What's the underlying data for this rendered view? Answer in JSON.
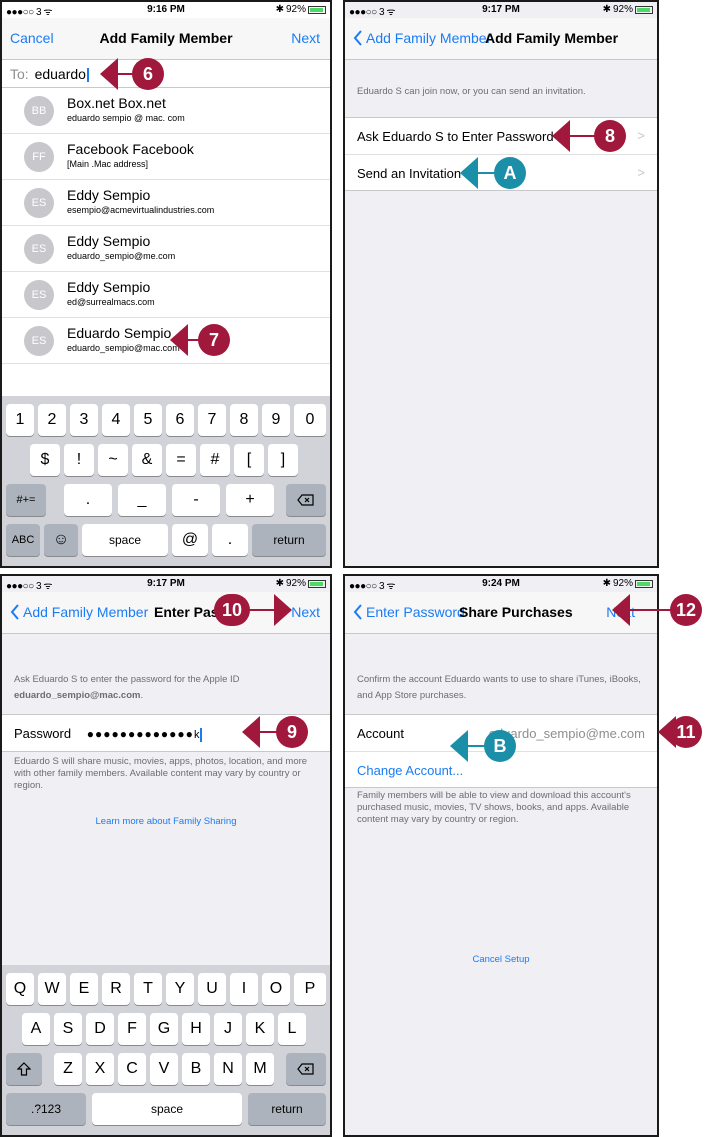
{
  "colors": {
    "ios_blue": "#1a7cf5",
    "callout_red": "#a0183c",
    "callout_teal": "#1c8fa8"
  },
  "panel1": {
    "status": {
      "carrier": "●●●○○ 3 ᯤ",
      "time": "9:16 PM",
      "battery": "92%",
      "battery_level": 0.92
    },
    "nav": {
      "left": "Cancel",
      "title": "Add Family Member",
      "right": "Next"
    },
    "to_label": "To:",
    "to_value": "eduardo",
    "contacts": [
      {
        "initials": "BB",
        "name": "Box.net Box.net",
        "email": "eduardo sempio @ mac. com"
      },
      {
        "initials": "FF",
        "name": "Facebook Facebook",
        "email": "[Main .Mac address]"
      },
      {
        "initials": "ES",
        "name": "Eddy Sempio",
        "email": "esempio@acmevirtualindustries.com"
      },
      {
        "initials": "ES",
        "name": "Eddy Sempio",
        "email": "eduardo_sempio@me.com"
      },
      {
        "initials": "ES",
        "name": "Eddy Sempio",
        "email": "ed@surrealmacs.com"
      },
      {
        "initials": "ES",
        "name": "Eduardo Sempio",
        "email": "eduardo_sempio@mac.com"
      }
    ],
    "keyboard": {
      "row1": [
        "1",
        "2",
        "3",
        "4",
        "5",
        "6",
        "7",
        "8",
        "9",
        "0"
      ],
      "row2": [
        "$",
        "!",
        "~",
        "&",
        "=",
        "#",
        "[",
        "]"
      ],
      "row3": [
        ".",
        "_",
        "-",
        "+"
      ],
      "row3_left": "#+=",
      "backspace_icon": "backspace-icon",
      "abc": "ABC",
      "emoji": "☺",
      "space": "space",
      "at": "@",
      "dot": ".",
      "return": "return"
    },
    "callouts": {
      "to": "6",
      "contact": "7"
    }
  },
  "panel2": {
    "status": {
      "carrier": "●●●○○ 3 ᯤ",
      "time": "9:17 PM",
      "battery": "92%",
      "battery_level": 0.92
    },
    "nav": {
      "back": "Add Family Member",
      "title": "Add Family Member"
    },
    "info": "Eduardo S can join now, or you can send an invitation.",
    "options": [
      "Ask Eduardo S to Enter Password",
      "Send an Invitation"
    ],
    "callouts": {
      "ask": "8",
      "send": "A"
    }
  },
  "panel3": {
    "status": {
      "carrier": "●●●○○ 3 ᯤ",
      "time": "9:17 PM",
      "battery": "92%",
      "battery_level": 0.92
    },
    "nav": {
      "back": "Add Family Member",
      "title": "Enter Pass",
      "right": "Next"
    },
    "info_line1": "Ask Eduardo S to enter the password for the Apple ID",
    "info_email": "eduardo_sempio@mac.com",
    "info_end": ".",
    "password_label": "Password",
    "password_dots": "●●●●●●●●●●●●●",
    "password_last": "k",
    "footnote": "Eduardo S will share music, movies, apps, photos, location, and more with other family members. Available content may vary by country or region.",
    "learn_more": "Learn more about Family Sharing",
    "keyboard": {
      "row1": [
        "Q",
        "W",
        "E",
        "R",
        "T",
        "Y",
        "U",
        "I",
        "O",
        "P"
      ],
      "row2": [
        "A",
        "S",
        "D",
        "F",
        "G",
        "H",
        "J",
        "K",
        "L"
      ],
      "row3": [
        "Z",
        "X",
        "C",
        "V",
        "B",
        "N",
        "M"
      ],
      "shift_icon": "shift-icon",
      "backspace_icon": "backspace-icon",
      "numbers": ".?123",
      "space": "space",
      "return": "return"
    },
    "callouts": {
      "next": "10",
      "password": "9"
    }
  },
  "panel4": {
    "status": {
      "carrier": "●●●○○ 3 ᯤ",
      "time": "9:24 PM",
      "battery": "92%",
      "battery_level": 0.92
    },
    "nav": {
      "back": "Enter Password",
      "title": "Share Purchases",
      "right": "Next"
    },
    "info": "Confirm the account Eduardo wants to use to share iTunes, iBooks, and App Store purchases.",
    "account_label": "Account",
    "account_value": "eduardo_sempio@me.com",
    "change_account": "Change Account...",
    "footnote": "Family members will be able to view and download this account's purchased music, movies, TV shows, books, and apps. Available content may vary by country or region.",
    "cancel_setup": "Cancel Setup",
    "callouts": {
      "next": "12",
      "account": "11",
      "change": "B"
    }
  }
}
